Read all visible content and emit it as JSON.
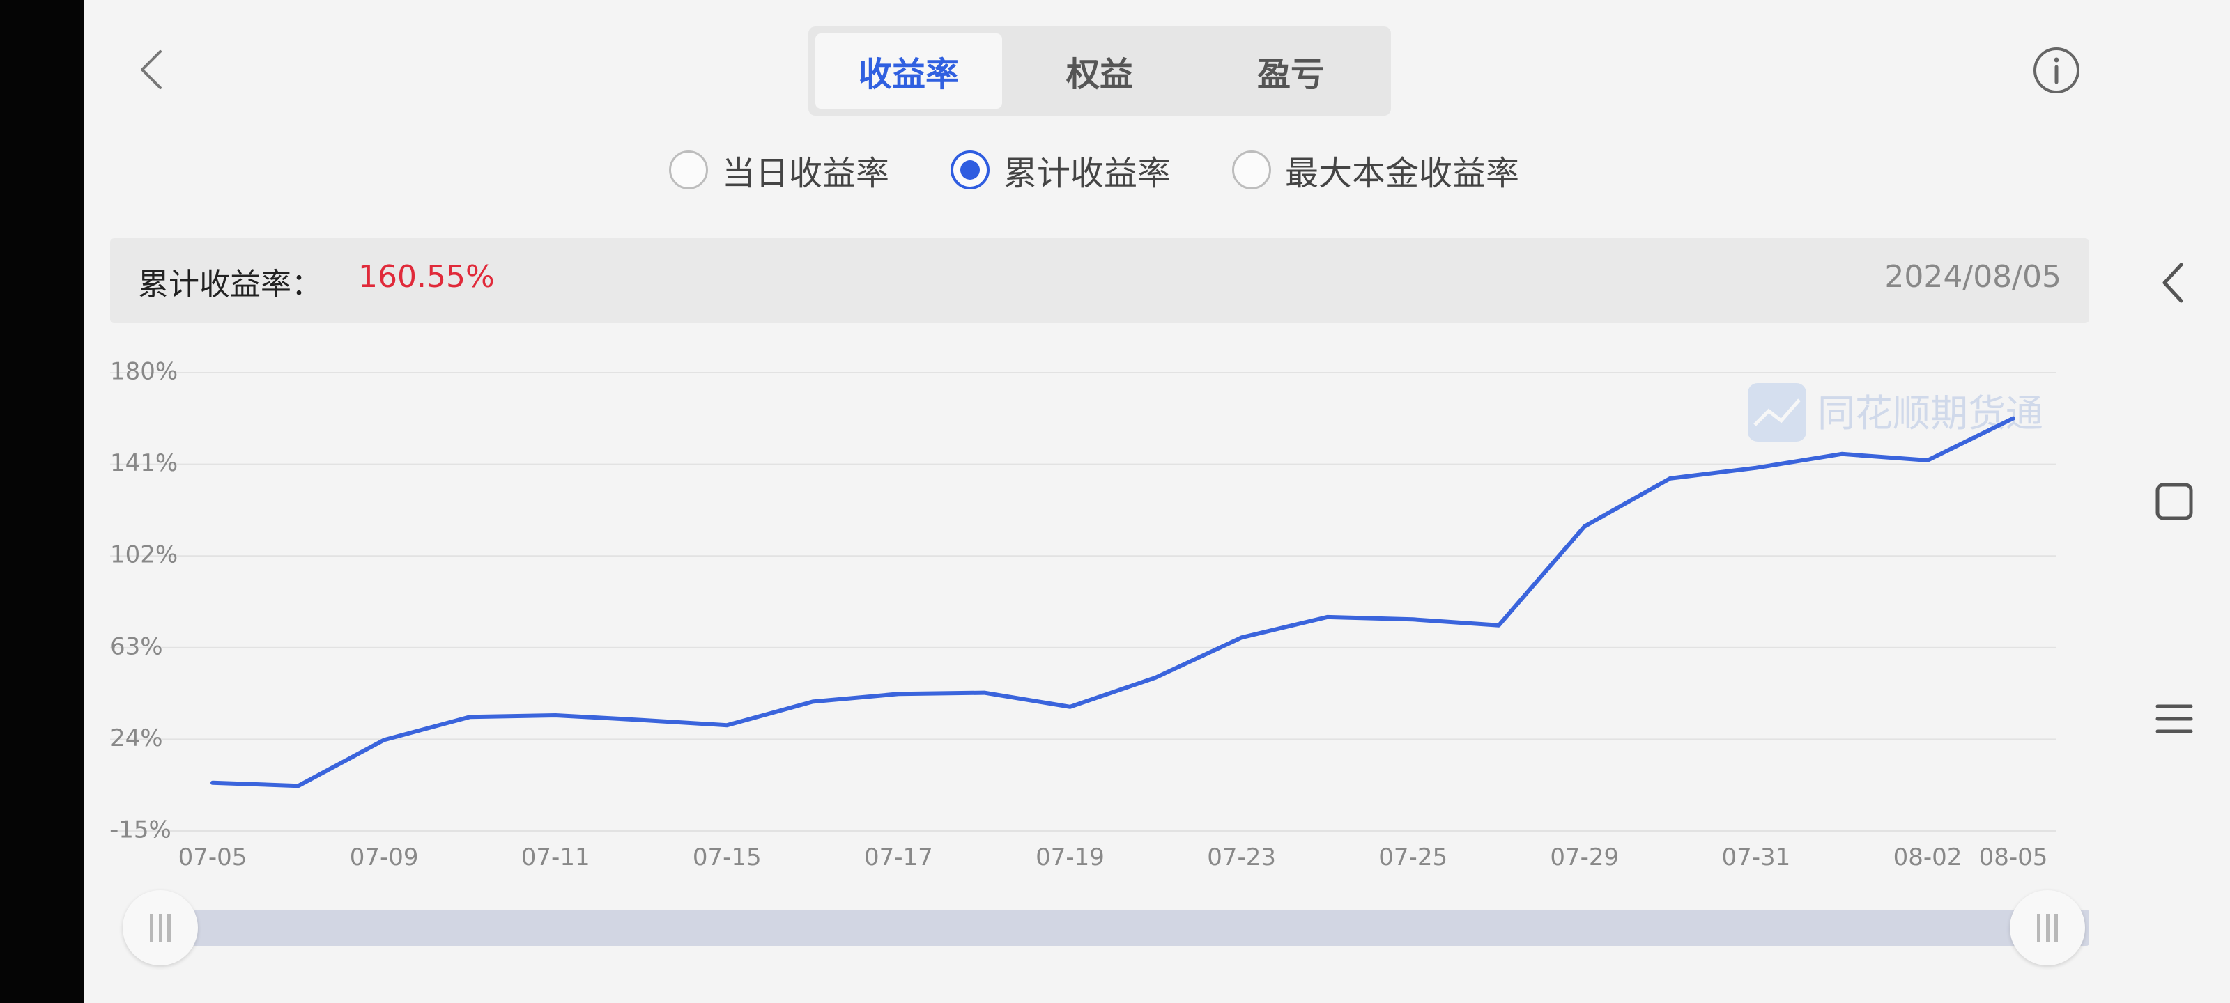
{
  "tabs": [
    {
      "label": "收益率",
      "active": true
    },
    {
      "label": "权益",
      "active": false
    },
    {
      "label": "盈亏",
      "active": false
    }
  ],
  "radios": [
    {
      "label": "当日收益率",
      "checked": false
    },
    {
      "label": "累计收益率",
      "checked": true
    },
    {
      "label": "最大本金收益率",
      "checked": false
    }
  ],
  "summary": {
    "label": "累计收益率：",
    "value": "160.55%",
    "date": "2024/08/05"
  },
  "watermark": "同花顺期货通",
  "icons": {
    "back": "chevron-left-icon",
    "info": "info-icon",
    "nav_back": "chevron-left-icon",
    "nav_home": "square-icon",
    "nav_menu": "menu-icon"
  },
  "colors": {
    "accent": "#3060e0",
    "value_red": "#e02a3a",
    "line": "#3a64dc",
    "scroll_track": "#d2d6e3"
  },
  "chart_data": {
    "type": "line",
    "ylim": [
      -15,
      180
    ],
    "y_ticks": [
      "180%",
      "141%",
      "102%",
      "63%",
      "24%",
      "-15%"
    ],
    "x_tick_labels": [
      "07-05",
      "07-09",
      "07-11",
      "07-15",
      "07-17",
      "07-19",
      "07-23",
      "07-25",
      "07-29",
      "07-31",
      "08-02",
      "08-05"
    ],
    "x": [
      "07-05",
      "07-08",
      "07-09",
      "07-10",
      "07-11",
      "07-12",
      "07-15",
      "07-16",
      "07-17",
      "07-18",
      "07-19",
      "07-22",
      "07-23",
      "07-24",
      "07-25",
      "07-26",
      "07-29",
      "07-30",
      "07-31",
      "08-01",
      "08-02",
      "08-05"
    ],
    "series": [
      {
        "values": [
          5.5,
          4.2,
          23.7,
          33.5,
          34.2,
          32.2,
          30.0,
          40.0,
          43.3,
          43.8,
          37.8,
          50.3,
          67.3,
          76.0,
          75.0,
          72.5,
          114.6,
          135.0,
          139.5,
          145.4,
          142.7,
          160.55
        ]
      }
    ],
    "grid": true
  }
}
